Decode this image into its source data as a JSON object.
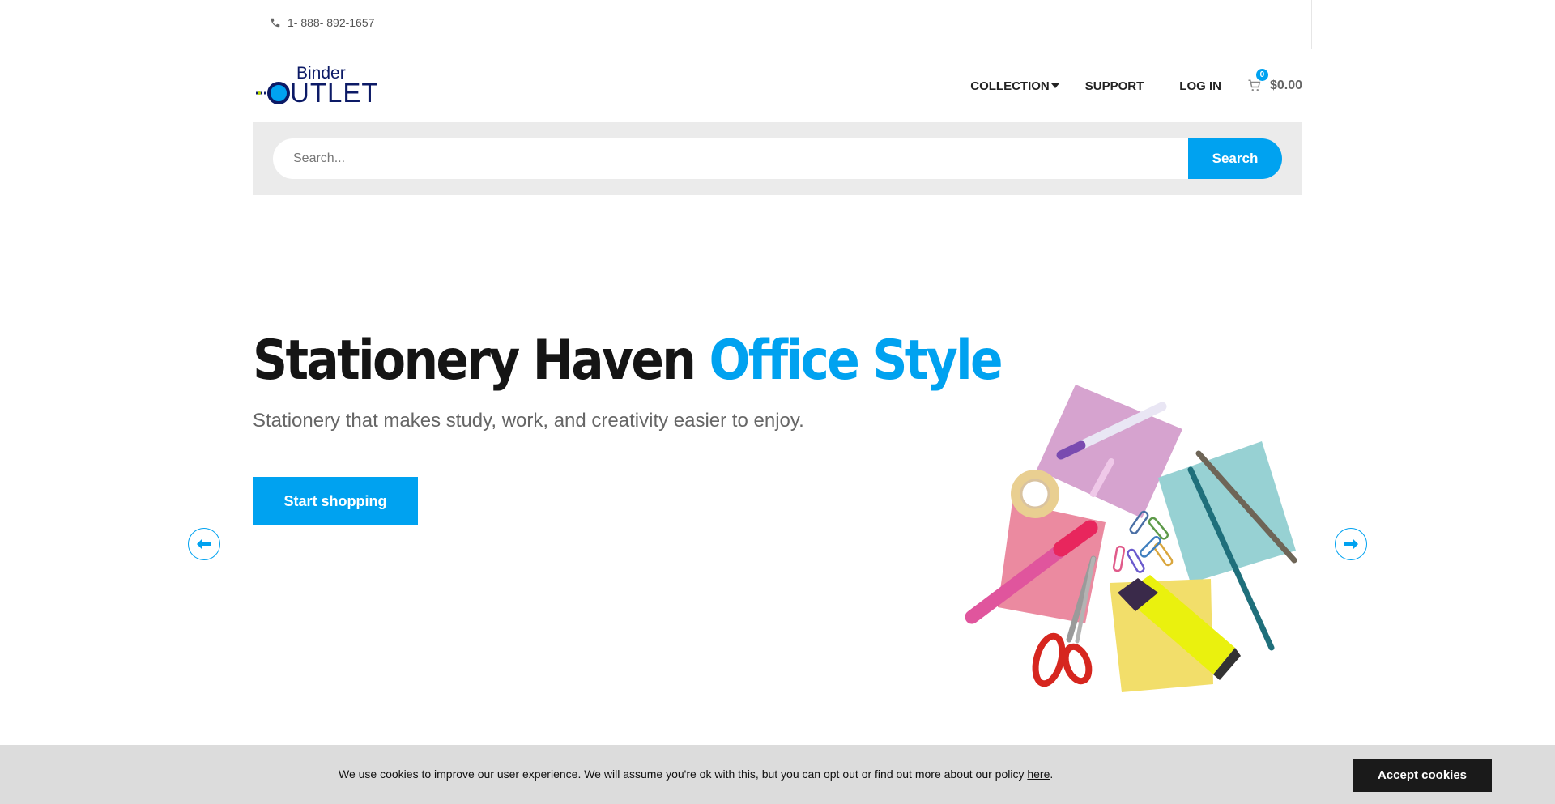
{
  "topbar": {
    "phone": "1- 888- 892-1657",
    "phone_icon": "phone-icon"
  },
  "logo": {
    "line1": "Binder",
    "line2": "UTLET"
  },
  "nav": {
    "collection": "COLLECTION",
    "support": "SUPPORT",
    "login": "LOG IN",
    "cart_count": "0",
    "cart_total": "$0.00",
    "cart_icon": "cart-icon"
  },
  "search": {
    "placeholder": "Search...",
    "button": "Search"
  },
  "hero": {
    "title_main": "Stationery Haven",
    "title_accent": "Office Style",
    "subtitle": "Stationery that makes study, work, and creativity easier to enjoy.",
    "cta": "Start shopping"
  },
  "cookie": {
    "text": "We use cookies to improve our user experience. We will assume you're ok with this, but you can opt out or find out more about our policy ",
    "link": "here",
    "end": ".",
    "button": "Accept cookies"
  },
  "colors": {
    "accent": "#00a2f0",
    "dark": "#151515",
    "cookie_bg": "#dcdcdc"
  }
}
